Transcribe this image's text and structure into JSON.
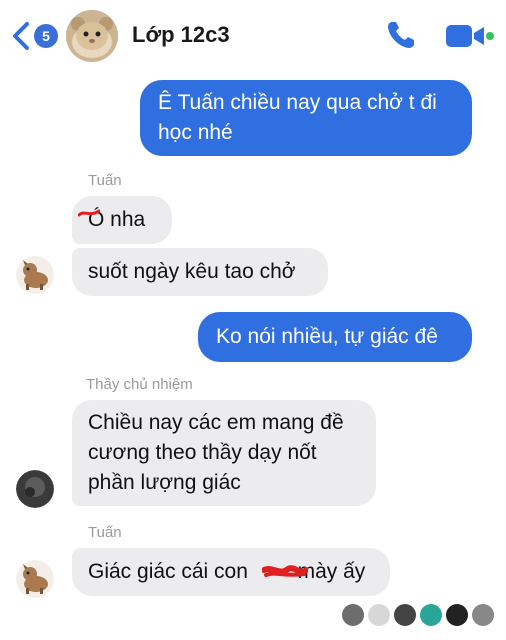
{
  "header": {
    "back_badge": "5",
    "title": "Lớp 12c3",
    "icons": [
      "back-chevron-icon",
      "phone-icon",
      "video-camera-icon"
    ],
    "accent_color": "#2f6fe0"
  },
  "messages": [
    {
      "direction": "outgoing",
      "text_line1": "Ê Tuấn chiều nay qua chở t đi",
      "text_line2": "học nhé"
    },
    {
      "direction": "incoming",
      "sender": "Tuấn",
      "text": "Ó nha"
    },
    {
      "direction": "incoming",
      "text": "suốt ngày kêu tao chở"
    },
    {
      "direction": "outgoing",
      "text": "Ko nói nhiều, tự giác đê"
    },
    {
      "direction": "incoming",
      "sender": "Thầy chủ nhiệm",
      "text_line1": "Chiều nay các em mang đề",
      "text_line2": "cương theo thầy dạy nốt",
      "text_line3": "phần lượng giác"
    },
    {
      "direction": "incoming",
      "sender": "Tuấn",
      "text_before": "Giác giác cái con",
      "text_after": "mày ấy"
    }
  ],
  "read_receipts_count": 6
}
